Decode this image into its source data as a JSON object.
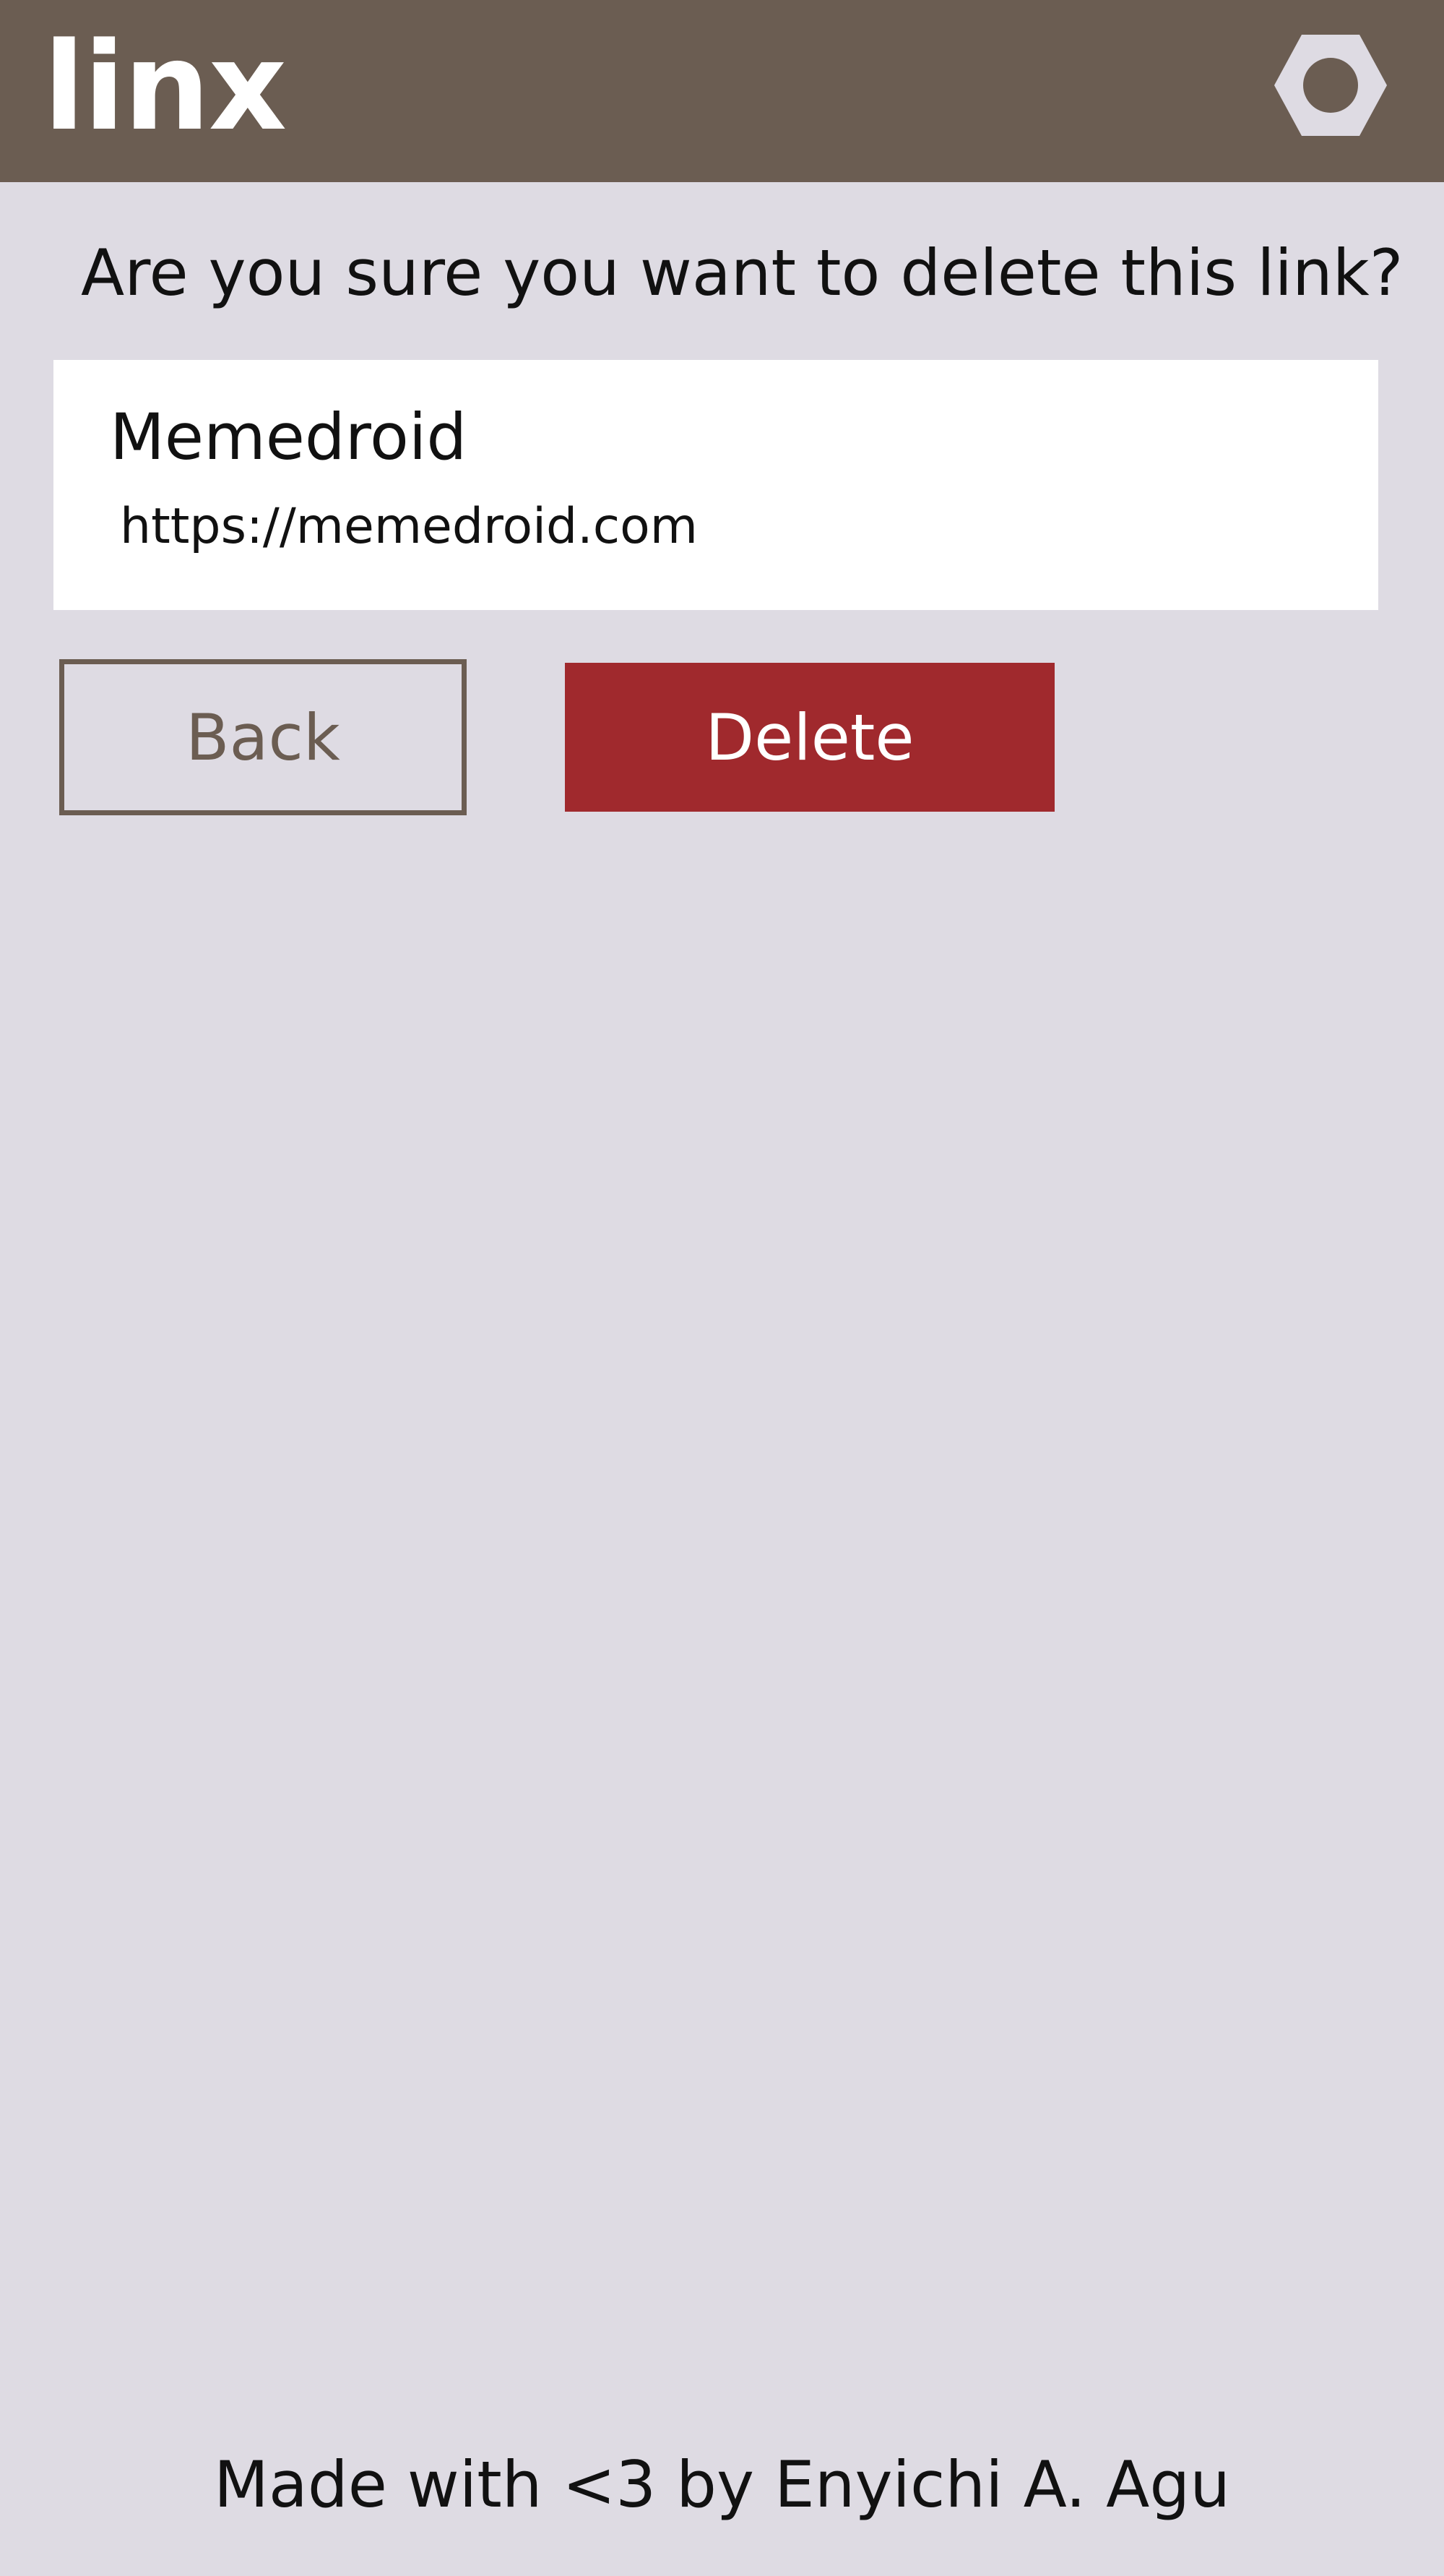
{
  "header": {
    "logo_text": "linx",
    "settings_icon": "hexagon-settings-icon"
  },
  "dialog": {
    "prompt": "Are you sure you want to delete this link?",
    "link": {
      "title": "Memedroid",
      "url": "https://memedroid.com"
    },
    "back_label": "Back",
    "delete_label": "Delete"
  },
  "footer": {
    "credit": "Made with <3 by Enyichi A. Agu"
  },
  "colors": {
    "header_bg": "#6b5d52",
    "page_bg": "#dedbe3",
    "card_bg": "#ffffff",
    "delete_bg": "#a0292d",
    "back_border": "#6b5d52"
  }
}
